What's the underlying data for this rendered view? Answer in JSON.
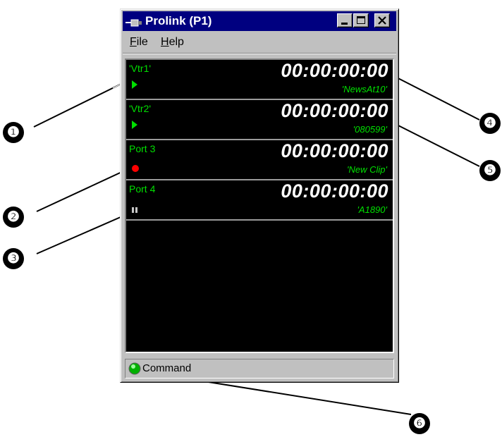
{
  "window": {
    "title": "Prolink (P1)",
    "menu": [
      {
        "label": "File",
        "accel": "F",
        "rest": "ile"
      },
      {
        "label": "Help",
        "accel": "H",
        "rest": "elp"
      }
    ]
  },
  "ports": [
    {
      "name": "'Vtr1'",
      "timecode": "00:00:00:00",
      "clip": "'NewsAt10'",
      "state": "play-icon"
    },
    {
      "name": "'Vtr2'",
      "timecode": "00:00:00:00",
      "clip": "'080599'",
      "state": "play-icon"
    },
    {
      "name": "Port 3",
      "timecode": "00:00:00:00",
      "clip": "'New Clip'",
      "state": "record-icon"
    },
    {
      "name": "Port 4",
      "timecode": "00:00:00:00",
      "clip": "'A1890'",
      "state": "pause-icon"
    }
  ],
  "status": {
    "text": "Command",
    "led_color": "#00d000"
  },
  "callouts": [
    "❶",
    "❷",
    "❸",
    "❹",
    "❺",
    "❻"
  ],
  "colors": {
    "port_text": "#00e000",
    "timecode_text": "#ffffff",
    "record": "#ff0000",
    "panel_bg": "#000000",
    "titlebar_bg": "#000080"
  }
}
